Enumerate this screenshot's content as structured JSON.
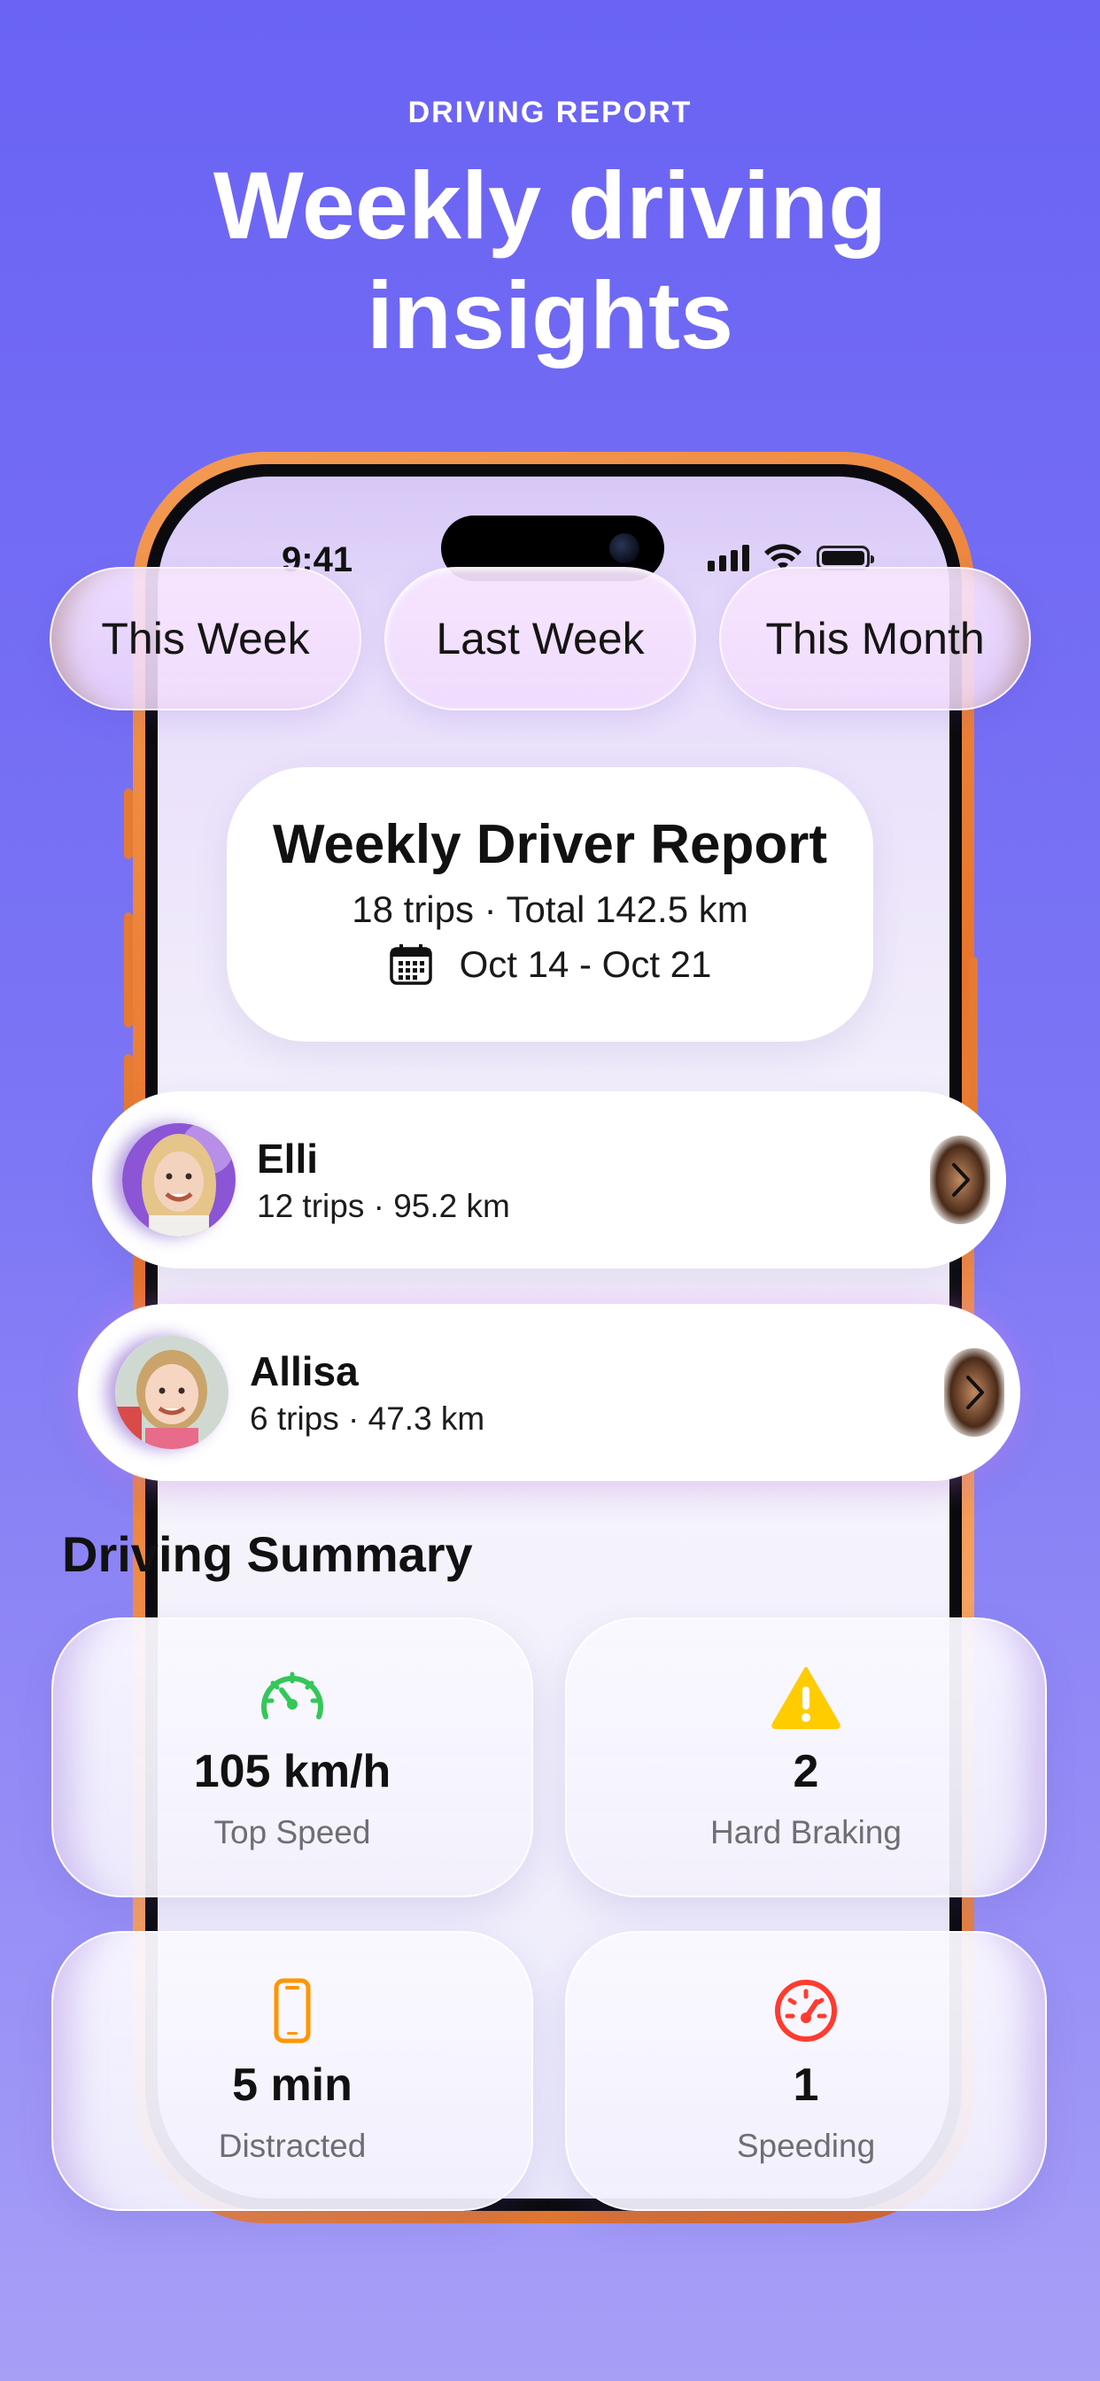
{
  "header": {
    "eyebrow": "DRIVING REPORT",
    "title_line1": "Weekly driving",
    "title_line2": "insights"
  },
  "status_bar": {
    "time": "9:41"
  },
  "period_tabs": [
    {
      "label": "This Week"
    },
    {
      "label": "Last Week"
    },
    {
      "label": "This Month"
    }
  ],
  "report": {
    "title": "Weekly Driver Report",
    "summary": "18 trips · Total 142.5 km",
    "date_range": "Oct 14 - Oct 21"
  },
  "drivers": [
    {
      "name": "Elli",
      "meta": "12 trips · 95.2 km"
    },
    {
      "name": "Allisa",
      "meta": "6 trips · 47.3 km"
    }
  ],
  "summary": {
    "title": "Driving Summary",
    "stats": [
      {
        "value": "105 km/h",
        "label": "Top Speed",
        "icon": "speedometer-icon",
        "color": "#34c759"
      },
      {
        "value": "2",
        "label": "Hard Braking",
        "icon": "warning-icon",
        "color": "#ffcc00"
      },
      {
        "value": "5 min",
        "label": "Distracted",
        "icon": "phone-icon",
        "color": "#ff9500"
      },
      {
        "value": "1",
        "label": "Speeding",
        "icon": "speed-limit-icon",
        "color": "#ff3b30"
      }
    ]
  }
}
